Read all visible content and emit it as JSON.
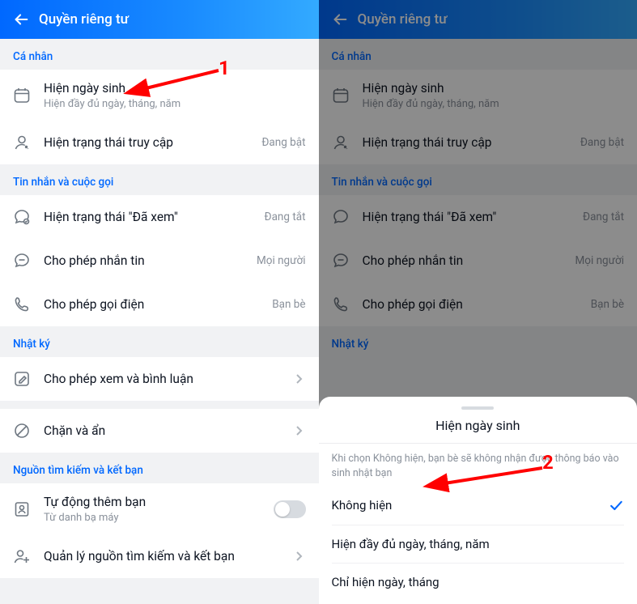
{
  "header": {
    "title": "Quyền riêng tư"
  },
  "sections": {
    "personal": {
      "header": "Cá nhân"
    },
    "messages": {
      "header": "Tin nhắn và cuộc gọi"
    },
    "diary": {
      "header": "Nhật ký"
    },
    "sources": {
      "header": "Nguồn tìm kiếm và kết bạn"
    }
  },
  "rows": {
    "birthday": {
      "title": "Hiện ngày sinh",
      "sub": "Hiện đầy đủ ngày, tháng, năm"
    },
    "online": {
      "title": "Hiện trạng thái truy cập",
      "value": "Đang bật"
    },
    "seen": {
      "title": "Hiện trạng thái \"Đã xem\"",
      "value": "Đang tắt"
    },
    "msg": {
      "title": "Cho phép nhắn tin",
      "value": "Mọi người"
    },
    "call": {
      "title": "Cho phép gọi điện",
      "value": "Bạn bè"
    },
    "viewcmt": {
      "title": "Cho phép xem và bình luận"
    },
    "block": {
      "title": "Chặn và ẩn"
    },
    "autoadd": {
      "title": "Tự động thêm bạn",
      "sub": "Từ danh bạ máy"
    },
    "sourcesmgr": {
      "title": "Quản lý nguồn tìm kiếm và kết bạn"
    }
  },
  "sheet": {
    "title": "Hiện ngày sinh",
    "desc": "Khi chọn Không hiện, bạn bè sẽ không nhận được thông báo vào sinh nhật bạn",
    "opt1": "Không hiện",
    "opt2": "Hiện đầy đủ ngày, tháng, năm",
    "opt3": "Chỉ hiện ngày, tháng"
  },
  "annot": {
    "n1": "1",
    "n2": "2"
  }
}
